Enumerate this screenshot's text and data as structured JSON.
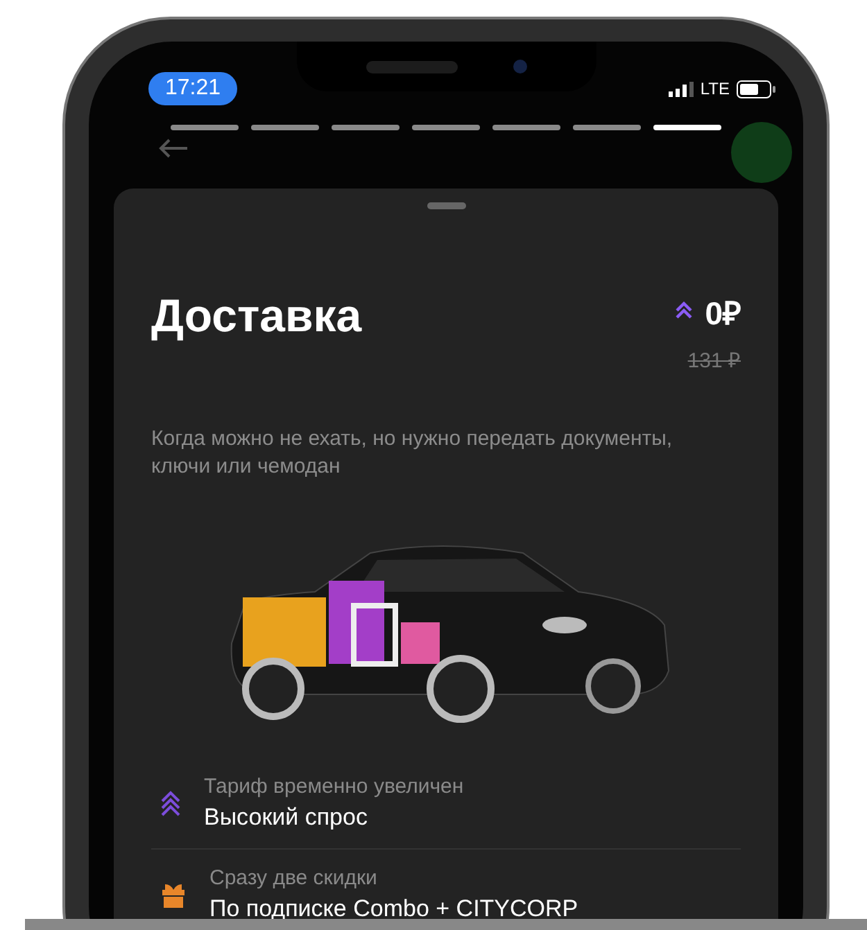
{
  "status_bar": {
    "time": "17:21",
    "network": "LTE"
  },
  "story_progress": [
    {
      "selected": false
    },
    {
      "selected": false
    },
    {
      "selected": false
    },
    {
      "selected": false
    },
    {
      "selected": false
    },
    {
      "selected": false
    },
    {
      "selected": true
    }
  ],
  "sheet": {
    "title": "Доставка",
    "price": "0₽",
    "old_price": "131 ₽",
    "description": "Когда можно не ехать, но нужно передать документы, ключи или чемодан",
    "items": [
      {
        "kind": "surge",
        "caption": "Тариф временно увеличен",
        "title": "Высокий спрос"
      },
      {
        "kind": "gift",
        "caption": "Сразу две скидки",
        "title": "По подписке Combo + CITYCORP"
      }
    ]
  }
}
